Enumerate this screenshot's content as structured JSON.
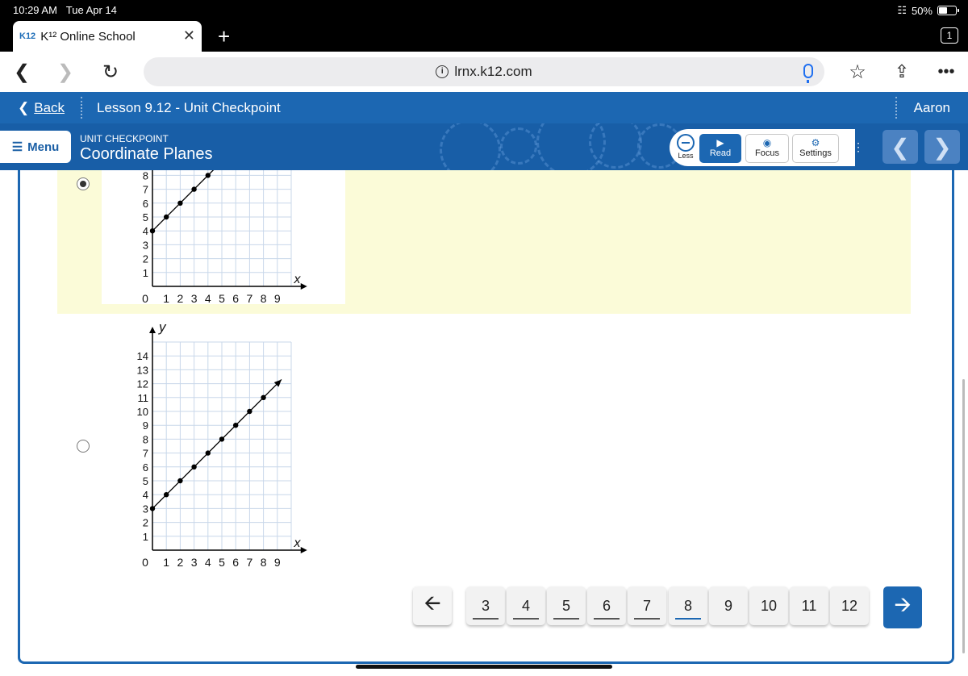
{
  "status": {
    "time": "10:29 AM",
    "date": "Tue Apr 14",
    "battery": "50%"
  },
  "browser": {
    "tab_logo": "K12",
    "tab_title": "K¹² Online School",
    "tab_count": "1",
    "url": "lrnx.k12.com"
  },
  "lesson": {
    "back": "Back",
    "title": "Lesson 9.12 - Unit Checkpoint",
    "user": "Aaron"
  },
  "unit": {
    "menu": "Menu",
    "kicker": "UNIT CHECKPOINT",
    "title": "Coordinate Planes",
    "less": "Less",
    "read": "Read",
    "focus": "Focus",
    "settings": "Settings"
  },
  "answers": [
    {
      "selected": true,
      "x_label": "x",
      "y_ticks": [
        "1",
        "2",
        "3",
        "4",
        "5",
        "6",
        "7",
        "8"
      ],
      "x_ticks": [
        "1",
        "2",
        "3",
        "4",
        "5",
        "6",
        "7",
        "8",
        "9"
      ],
      "origin": "0",
      "points": [
        [
          0,
          4
        ],
        [
          1,
          5
        ],
        [
          2,
          6
        ],
        [
          3,
          7
        ],
        [
          4,
          8
        ]
      ]
    },
    {
      "selected": false,
      "x_label": "x",
      "y_label": "y",
      "y_ticks": [
        "1",
        "2",
        "3",
        "4",
        "5",
        "6",
        "7",
        "8",
        "9",
        "10",
        "11",
        "12",
        "13",
        "14"
      ],
      "x_ticks": [
        "1",
        "2",
        "3",
        "4",
        "5",
        "6",
        "7",
        "8",
        "9"
      ],
      "origin": "0",
      "points": [
        [
          0,
          3
        ],
        [
          1,
          4
        ],
        [
          2,
          5
        ],
        [
          3,
          6
        ],
        [
          4,
          7
        ],
        [
          5,
          8
        ],
        [
          6,
          9
        ],
        [
          7,
          10
        ],
        [
          8,
          11
        ]
      ]
    }
  ],
  "pager": {
    "pages": [
      "3",
      "4",
      "5",
      "6",
      "7",
      "8",
      "9",
      "10",
      "11",
      "12"
    ],
    "current": "8"
  }
}
